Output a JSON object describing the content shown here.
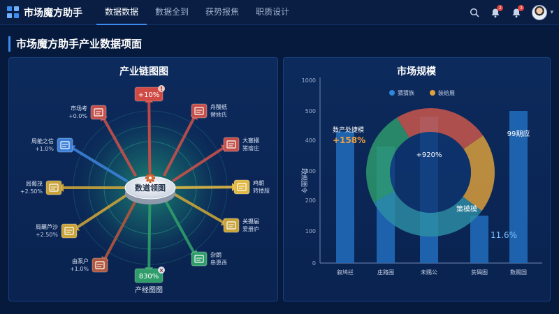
{
  "app": {
    "title": "市场魔方助手"
  },
  "nav": {
    "tabs": [
      {
        "label": "数据数据",
        "active": true
      },
      {
        "label": "數据全到",
        "active": false
      },
      {
        "label": "获势报焦",
        "active": false
      },
      {
        "label": "职质设计",
        "active": false
      }
    ]
  },
  "header_icons": {
    "search": "search-icon",
    "notifications": {
      "icon": "bell-icon",
      "badge": "2"
    },
    "alerts": {
      "icon": "bell-icon",
      "badge": "3"
    }
  },
  "page": {
    "title": "市场魔方助手产业数据项面"
  },
  "industry_chain": {
    "title": "产业链图图",
    "center_label": "数道领图",
    "bottom_label": "产经图图",
    "nodes": [
      {
        "name": "",
        "value": "+10%",
        "color": "#d04b45",
        "icon": "chart-icon"
      },
      {
        "name": "舟酸纸",
        "value": "替她氏",
        "color": "#c4504a",
        "icon": "document-icon"
      },
      {
        "name": "大塞摆",
        "value": "猪瘤庄",
        "color": "#c4504a",
        "icon": "chart-icon"
      },
      {
        "name": "鸡朝",
        "value": "转搂服",
        "color": "#e0b844",
        "icon": "document-icon"
      },
      {
        "name": "关摄届",
        "value": "爱册庐",
        "color": "#c9a23a",
        "icon": "tools-icon"
      },
      {
        "name": "杂朗",
        "value": "串惠孫",
        "color": "#2f9d6a",
        "icon": "camera-icon"
      },
      {
        "name": "",
        "value": "830%",
        "color": "#2f9d6a",
        "icon": "close-icon"
      },
      {
        "name": "由泵户",
        "value": "+1.0%",
        "color": "#b0573e",
        "icon": "car-icon"
      },
      {
        "name": "局蘸芦沙",
        "value": "+2.50%",
        "color": "#c9a23a",
        "icon": "document-icon"
      },
      {
        "name": "局葡茂",
        "value": "+2.50%",
        "color": "#c9a23a",
        "icon": "chart-icon"
      },
      {
        "name": "局能之信",
        "value": "+1.0%",
        "color": "#3b7fd8",
        "icon": "laptop-icon"
      },
      {
        "name": "市场考",
        "value": "+0.0%",
        "color": "#c4504a",
        "icon": "monitor-icon"
      }
    ]
  },
  "market_scale": {
    "title": "市场规模",
    "ylabel": "政规图令",
    "bar_label_right": "99期应",
    "annotation_growth_label": "数产处捷模",
    "annotation_growth_value": "+158%",
    "donut_center_value": "+920%",
    "donut_label": "策模模",
    "donut_highlight_value": "11.6%"
  },
  "chart_data": {
    "type": "bar",
    "title": "市场规模",
    "xlabel": "",
    "ylabel": "政规图令",
    "categories": [
      "叙鸠拦",
      "庄路围",
      "未赐公",
      "贫碣图",
      "数赐国"
    ],
    "ylim": [
      0,
      1000
    ],
    "yticks": [
      0,
      100,
      200,
      300,
      400,
      500,
      1000,
      1500
    ],
    "legend": [
      "猜猜族",
      "装给展"
    ],
    "legend_colors": [
      "#2f86d8",
      "#e0a23a"
    ],
    "series": [
      {
        "values": [
          430,
          380,
          480,
          150,
          500
        ]
      }
    ],
    "donut": {
      "values": [
        24,
        20,
        32,
        24
      ],
      "colors": [
        "#d0584a",
        "#e0a23a",
        "#2d8fa6",
        "#2e9c6c"
      ]
    }
  },
  "colors": {
    "accent": "#3b8df0",
    "background": "#061a3d",
    "panel": "#0c2a5c"
  }
}
